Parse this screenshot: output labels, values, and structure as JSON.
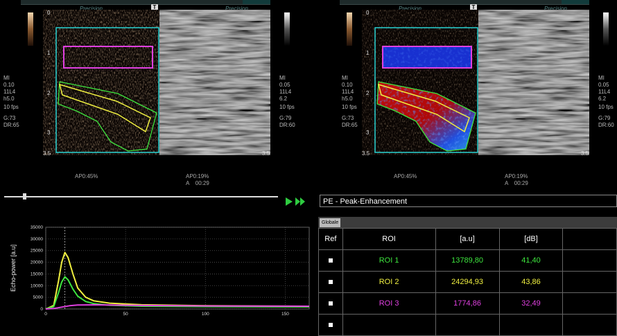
{
  "left_panel": {
    "precision_labels": [
      "Precision",
      "Precision"
    ],
    "t_button": "T",
    "info_left": [
      "MI",
      "0.10",
      "11L4",
      "h5.0",
      "",
      "10 fps",
      "",
      "G:73",
      "DR:65"
    ],
    "info_right": [
      "MI",
      "0.05",
      "11L4",
      "6.2",
      "",
      "10 fps",
      "",
      "G:79",
      "DR:60"
    ],
    "depth_labels": [
      "0",
      "1",
      "2",
      "3",
      "3.5"
    ],
    "depth_end_right": "3.5",
    "ap_left": "AP0:45%",
    "ap_right_line1": "AP0:19%",
    "ap_right_line2": "A    00:29"
  },
  "right_panel": {
    "precision_labels": [
      "Precision",
      "Precision"
    ],
    "t_button": "T",
    "info_left": [
      "MI",
      "0.10",
      "11L4",
      "h5.0",
      "",
      "10 fps",
      "",
      "G:73",
      "DR:65"
    ],
    "info_right": [
      "MI",
      "0.05",
      "11L4",
      "6.2",
      "",
      "10 fps",
      "",
      "G:79",
      "DR:60"
    ],
    "depth_labels": [
      "0",
      "1",
      "2",
      "3",
      "3.5"
    ],
    "depth_end_right": "3.5",
    "ap_left": "AP0:45%",
    "ap_right_line1": "AP0:19%",
    "ap_right_line2": "A    00:29"
  },
  "parameter_box": "PE - Peak-Enhancement",
  "tab_label": "Globale",
  "table": {
    "headers": [
      "Ref",
      "ROI",
      "[a.u]",
      "[dB]"
    ],
    "rows": [
      {
        "roi": "ROI 1",
        "au": "13789,80",
        "db": "41,40",
        "color": "#3ee63e"
      },
      {
        "roi": "ROI 2",
        "au": "24294,93",
        "db": "43,86",
        "color": "#f0f040"
      },
      {
        "roi": "ROI 3",
        "au": "1774,86",
        "db": "32,49",
        "color": "#e040e0"
      }
    ]
  },
  "chart_data": {
    "type": "line",
    "ylabel": "Echo-power [a.u]",
    "xlabel": "",
    "x_ticks": [
      0,
      50,
      100,
      150
    ],
    "y_ticks": [
      0,
      5000,
      10000,
      15000,
      20000,
      25000,
      30000,
      35000
    ],
    "xlim": [
      0,
      165
    ],
    "ylim": [
      0,
      35000
    ],
    "series": [
      {
        "color": "#f0f040",
        "x": [
          0,
          5,
          8,
          10,
          12,
          14,
          17,
          20,
          25,
          30,
          40,
          60,
          100,
          165
        ],
        "y": [
          0,
          1500,
          12000,
          20000,
          24200,
          22000,
          15000,
          9000,
          5000,
          3500,
          2500,
          1800,
          1400,
          1200
        ]
      },
      {
        "color": "#3ee63e",
        "x": [
          0,
          5,
          8,
          10,
          12,
          14,
          17,
          20,
          25,
          30,
          40,
          60,
          100,
          165
        ],
        "y": [
          0,
          1000,
          7000,
          11500,
          13800,
          12500,
          8500,
          5500,
          3200,
          2300,
          1600,
          1200,
          1000,
          900
        ]
      },
      {
        "color": "#e040e0",
        "x": [
          0,
          5,
          10,
          15,
          20,
          30,
          40,
          60,
          100,
          165
        ],
        "y": [
          0,
          200,
          800,
          1400,
          1700,
          1770,
          1700,
          1500,
          1300,
          1200
        ]
      }
    ]
  },
  "colors": {
    "cyan_box": "#29d3d3",
    "magenta_roi": "#e040e0",
    "yellow_roi": "#f0f040",
    "green_roi": "#3ee63e",
    "play_green": "#2ecc40"
  }
}
